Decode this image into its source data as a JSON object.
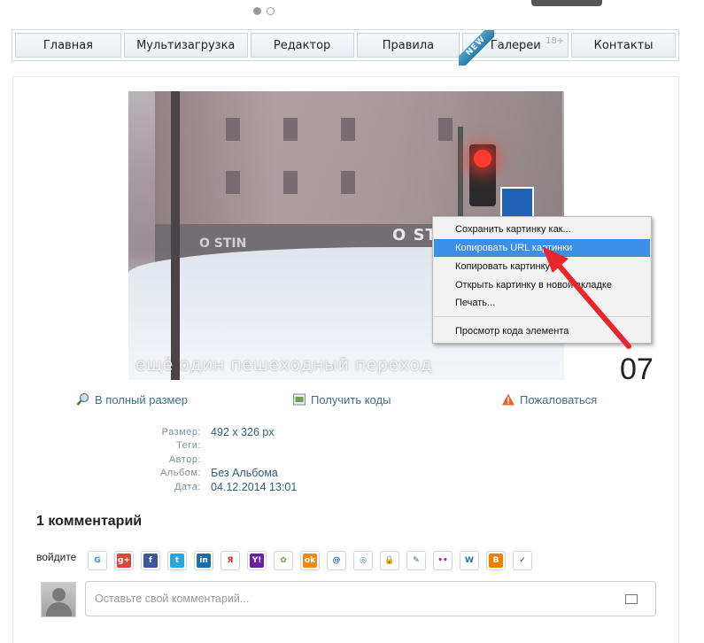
{
  "nav": {
    "items": [
      {
        "label": "Главная",
        "sup": ""
      },
      {
        "label": "Мультизагрузка",
        "sup": ""
      },
      {
        "label": "Редактор",
        "sup": ""
      },
      {
        "label": "Правила",
        "sup": ""
      },
      {
        "label": "Галереи",
        "sup": "18+"
      },
      {
        "label": "Контакты",
        "sup": ""
      }
    ],
    "new_badge": "NEW"
  },
  "photo": {
    "caption": "ещё один пешеходный переход",
    "sign_text": "O STIN",
    "sign_text2": "O STIN"
  },
  "context_menu": {
    "items": [
      "Сохранить картинку как...",
      "Копировать URL картинки",
      "Копировать картинку",
      "Открыть картинку в новой вкладке",
      "Печать...",
      "Просмотр кода элемента"
    ],
    "highlighted_index": 1
  },
  "annotation": {
    "number": "07",
    "arrow_color": "#e8262b"
  },
  "actions": {
    "full_size": "В полный размер",
    "get_codes": "Получить коды",
    "report": "Пожаловаться"
  },
  "meta": {
    "size_label": "Размер:",
    "size_value": "492 x 326 px",
    "tags_label": "Теги:",
    "tags_value": "",
    "author_label": "Автор:",
    "author_value": "",
    "album_label": "Альбом:",
    "album_value": "Без Альбома",
    "date_label": "Дата:",
    "date_value": "04.12.2014 13:01"
  },
  "comments": {
    "title": "1 комментарий",
    "login_label": "войдите",
    "placeholder": "Оставьте свой комментарий..."
  },
  "social": [
    {
      "name": "google-icon",
      "color": "#ffffff",
      "glyph": "G",
      "fg": "#4285f4"
    },
    {
      "name": "google-plus-icon",
      "color": "#d8473a",
      "glyph": "g+",
      "fg": "#ffffff"
    },
    {
      "name": "facebook-icon",
      "color": "#3b5998",
      "glyph": "f",
      "fg": "#ffffff"
    },
    {
      "name": "twitter-icon",
      "color": "#2ba3dc",
      "glyph": "t",
      "fg": "#ffffff"
    },
    {
      "name": "linkedin-icon",
      "color": "#1b6fa8",
      "glyph": "in",
      "fg": "#ffffff"
    },
    {
      "name": "yandex-icon",
      "color": "#ffffff",
      "glyph": "Я",
      "fg": "#e8261e"
    },
    {
      "name": "yahoo-icon",
      "color": "#6a1fa0",
      "glyph": "Y!",
      "fg": "#ffffff"
    },
    {
      "name": "flower-icon",
      "color": "#ffffff",
      "glyph": "✿",
      "fg": "#5aa83a"
    },
    {
      "name": "odnoklassniki-icon",
      "color": "#f08a12",
      "glyph": "ok",
      "fg": "#ffffff"
    },
    {
      "name": "mail-icon",
      "color": "#ffffff",
      "glyph": "@",
      "fg": "#1c6fc0"
    },
    {
      "name": "rambler-icon",
      "color": "#ffffff",
      "glyph": "◎",
      "fg": "#2b7cc8"
    },
    {
      "name": "lock-icon",
      "color": "#ffffff",
      "glyph": "🔒",
      "fg": "#444444"
    },
    {
      "name": "livejournal-icon",
      "color": "#ffffff",
      "glyph": "✎",
      "fg": "#2d5f8a"
    },
    {
      "name": "flickr-icon",
      "color": "#ffffff",
      "glyph": "••",
      "fg": "#d0158a"
    },
    {
      "name": "wordpress-icon",
      "color": "#ffffff",
      "glyph": "W",
      "fg": "#21759b"
    },
    {
      "name": "blogger-icon",
      "color": "#f57d00",
      "glyph": "B",
      "fg": "#ffffff"
    },
    {
      "name": "check-icon",
      "color": "#ffffff",
      "glyph": "✓",
      "fg": "#333333"
    }
  ]
}
